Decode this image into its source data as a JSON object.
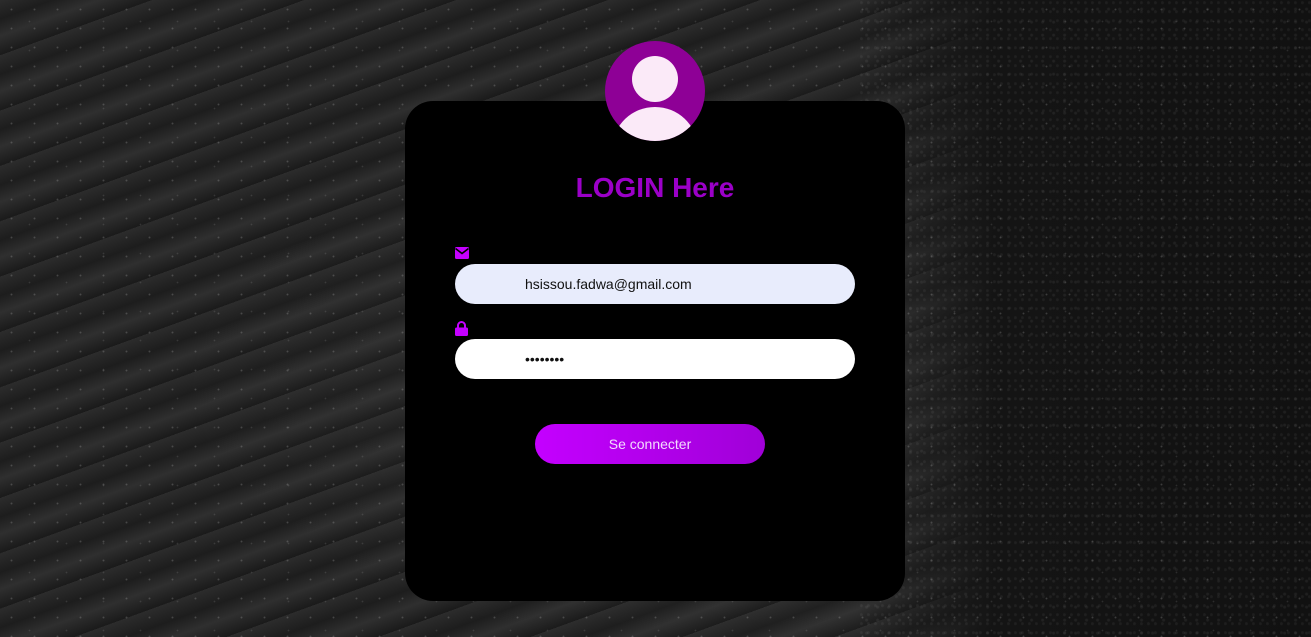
{
  "login": {
    "title": "LOGIN Here",
    "email": {
      "value": "hsissou.fadwa@gmail.com",
      "icon": "envelope-icon"
    },
    "password": {
      "value": "••••••••",
      "icon": "lock-icon"
    },
    "submit_label": "Se connecter",
    "avatar_icon": "user-avatar-icon"
  },
  "colors": {
    "accent": "#9b00c8",
    "button": "#c400ff",
    "avatar": "#8e0096",
    "card": "#000000"
  }
}
